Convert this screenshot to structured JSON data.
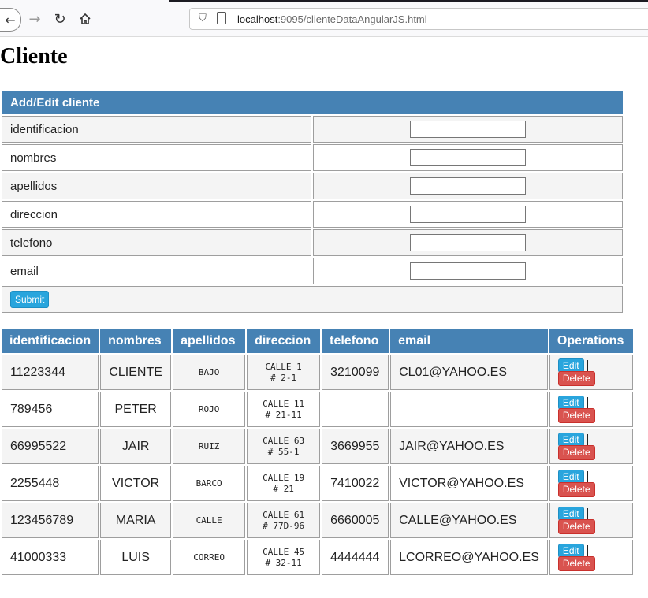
{
  "browser": {
    "url_host": "localhost",
    "url_rest": ":9095/clienteDataAngularJS.html"
  },
  "page_title": "Cliente",
  "form": {
    "header": "Add/Edit cliente",
    "fields": [
      {
        "label": "identificacion",
        "value": ""
      },
      {
        "label": "nombres",
        "value": ""
      },
      {
        "label": "apellidos",
        "value": ""
      },
      {
        "label": "direccion",
        "value": ""
      },
      {
        "label": "telefono",
        "value": ""
      },
      {
        "label": "email",
        "value": ""
      }
    ],
    "submit_label": "Submit"
  },
  "table": {
    "columns": [
      "identificacion",
      "nombres",
      "apellidos",
      "direccion",
      "telefono",
      "email",
      "Operations"
    ],
    "edit_label": "Edit",
    "delete_label": "Delete",
    "rows": [
      {
        "identificacion": "11223344",
        "nombres": "CLIENTE",
        "apellidos": "BAJO",
        "direccion_1": "CALLE 1",
        "direccion_2": "# 2-1",
        "telefono": "3210099",
        "email": "CL01@YAHOO.ES"
      },
      {
        "identificacion": "789456",
        "nombres": "PETER",
        "apellidos": "ROJO",
        "direccion_1": "CALLE 11",
        "direccion_2": "# 21-11",
        "telefono": "",
        "email": ""
      },
      {
        "identificacion": "66995522",
        "nombres": "JAIR",
        "apellidos": "RUIZ",
        "direccion_1": "CALLE 63",
        "direccion_2": "# 55-1",
        "telefono": "3669955",
        "email": "JAIR@YAHOO.ES"
      },
      {
        "identificacion": "2255448",
        "nombres": "VICTOR",
        "apellidos": "BARCO",
        "direccion_1": "CALLE 19",
        "direccion_2": "# 21",
        "telefono": "7410022",
        "email": "VICTOR@YAHOO.ES"
      },
      {
        "identificacion": "123456789",
        "nombres": "MARIA",
        "apellidos": "CALLE",
        "direccion_1": "CALLE 61",
        "direccion_2": "# 77D-96",
        "telefono": "6660005",
        "email": "CALLE@YAHOO.ES"
      },
      {
        "identificacion": "41000333",
        "nombres": "LUIS",
        "apellidos": "CORREO",
        "direccion_1": "CALLE 45",
        "direccion_2": "# 32-11",
        "telefono": "4444444",
        "email": "LCORREO@YAHOO.ES"
      }
    ]
  }
}
